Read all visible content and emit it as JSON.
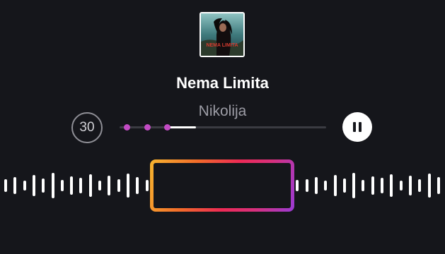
{
  "song": {
    "title": "Nema Limita",
    "artist": "Nikolija"
  },
  "cover": {
    "image_text": "NEMA LIMITA"
  },
  "controls": {
    "skip_seconds": "30"
  },
  "progress": {
    "played_fraction": 0.37,
    "marker_colors": [
      "#c24bc4",
      "#c24bc4",
      "#c24bc4"
    ]
  },
  "clip_selector": {
    "gradient_colors": [
      "#f7b52f",
      "#f26a2a",
      "#ee2a55",
      "#d8307c",
      "#9a3bd6"
    ]
  },
  "colors": {
    "background": "#15161b",
    "text_primary": "#ffffff",
    "text_secondary": "#9c9ca5",
    "marker": "#c24bc4"
  }
}
